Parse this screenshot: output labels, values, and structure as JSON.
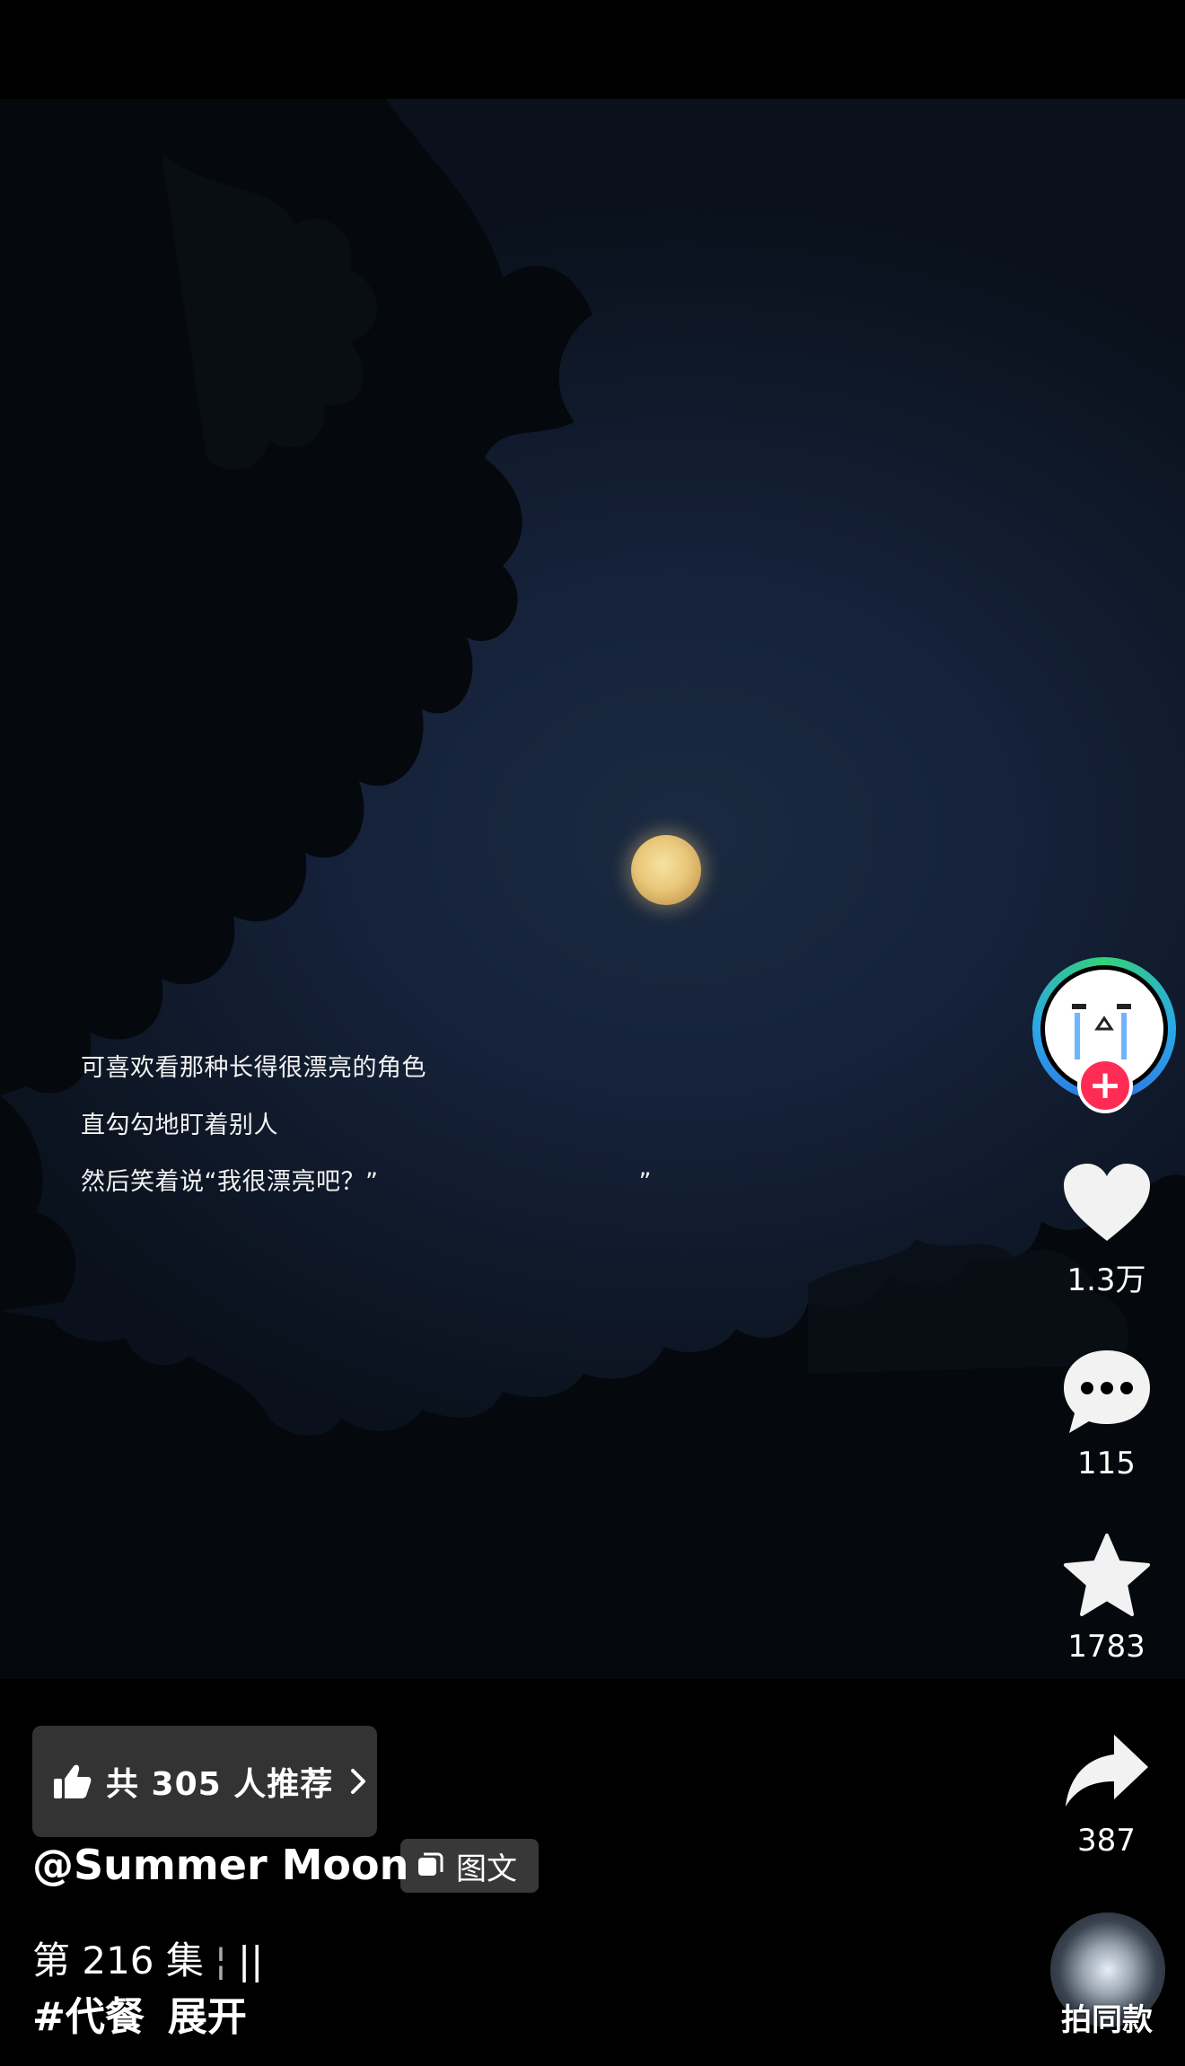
{
  "caption": {
    "line1": "可喜欢看那种长得很漂亮的角色",
    "line2": "直勾勾地盯着别人",
    "line3": "然后笑着说“我很漂亮吧？”",
    "line3_close": "”"
  },
  "actions": {
    "likes": "1.3万",
    "comments": "115",
    "favorites": "1783",
    "shares": "387"
  },
  "recommend": {
    "label": "共 305 人推荐"
  },
  "author": {
    "username": "@Summer Moon"
  },
  "post_type": {
    "label": "图文"
  },
  "episode": {
    "label": "第 216 集",
    "pause_icon": "||"
  },
  "hashtag": {
    "tag": "#代餐",
    "expand": "展开"
  },
  "same_style": {
    "label": "拍同款"
  },
  "colors": {
    "accent": "#fe2c55",
    "background": "#000000",
    "ring": "#2aa7e8"
  }
}
